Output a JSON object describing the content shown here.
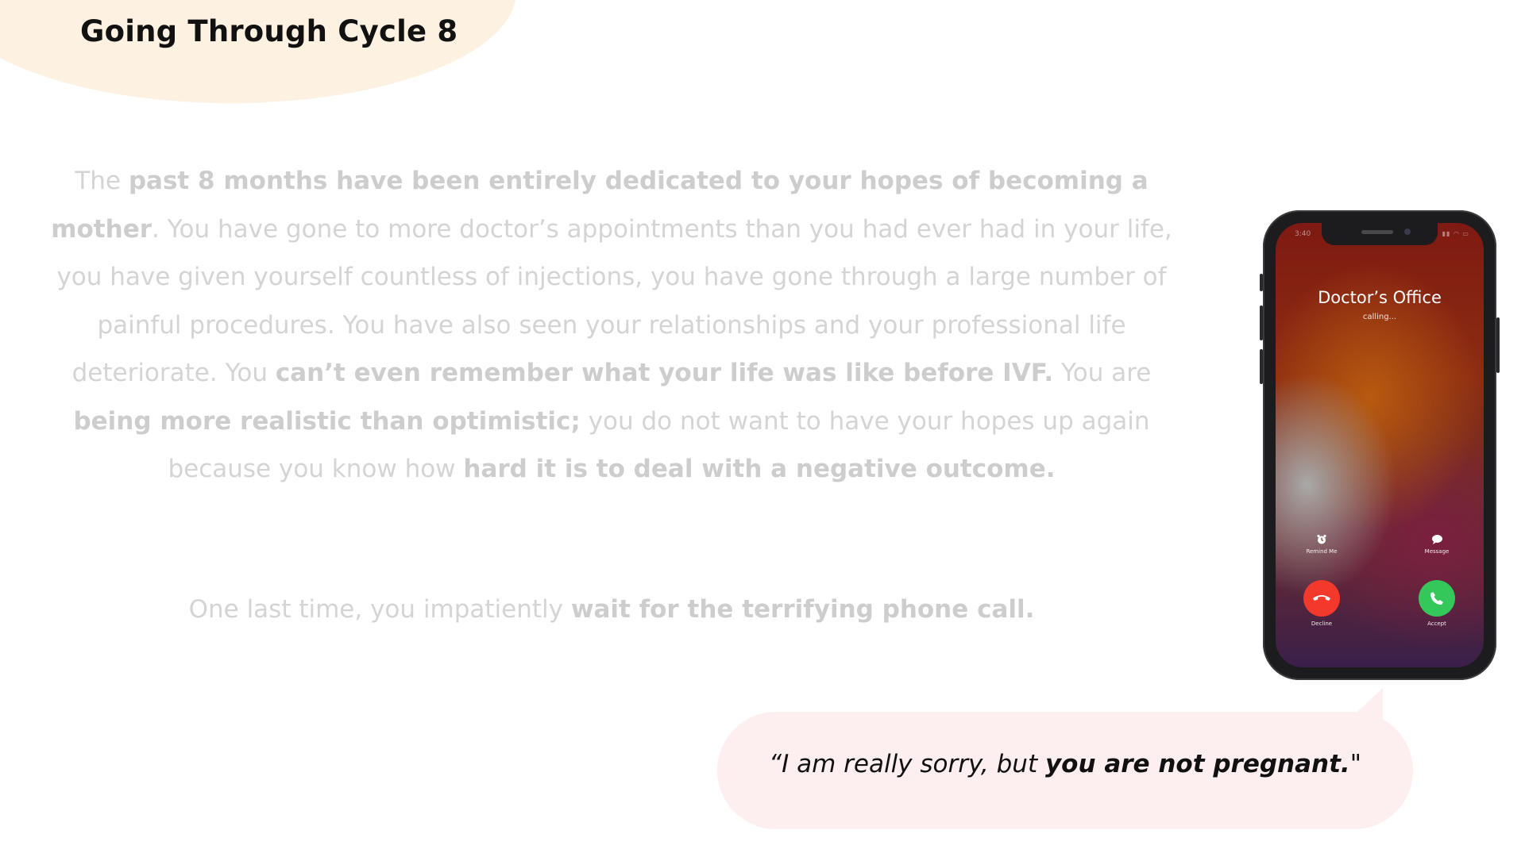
{
  "slide": {
    "title": "Going Through Cycle 8"
  },
  "paragraph1": {
    "s1": "The ",
    "b1": "past 8 months have been entirely dedicated to your hopes of becoming a mother",
    "s2": ". You have gone to more doctor’s appointments than you had ever had in your life, you have given yourself countless of injections, you have gone through a large number of painful procedures. You have also seen your relationships and your professional life deteriorate. You ",
    "b2": "can’t even remember what your life was like before IVF.",
    "s3": " You are ",
    "b3": "being more realistic than optimistic;",
    "s4": " you do not want to have your hopes up again because you know how ",
    "b4": "hard it is to deal with a negative outcome."
  },
  "paragraph2": {
    "s1": "One last time, you impatiently ",
    "b1": "wait for the terrifying phone call."
  },
  "phone": {
    "status_time": "3:40",
    "status_icons": "▮▮ ◠ ▭",
    "caller_name": "Doctor’s Office",
    "call_status": "calling...",
    "remind_label": "Remind Me",
    "message_label": "Message",
    "decline_label": "Decline",
    "accept_label": "Accept",
    "icons": {
      "remind": "alarm-clock-icon",
      "message": "speech-bubble-icon",
      "decline": "phone-hangup-icon",
      "accept": "phone-icon"
    },
    "colors": {
      "decline": "#f2392b",
      "accept": "#34c759"
    }
  },
  "quote": {
    "open": "“I am really sorry, but ",
    "bold": "you are not pregnant.",
    "close": "\""
  },
  "colors": {
    "title_blob": "#fdf1e1",
    "bubble": "#fdeff0",
    "faded_text": "#d4d4d4"
  }
}
